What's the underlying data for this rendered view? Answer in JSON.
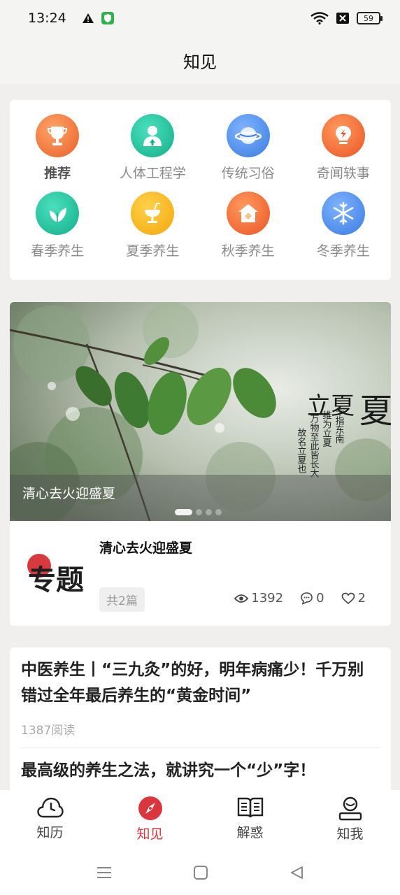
{
  "status_bar": {
    "time": "13:24",
    "battery": "59"
  },
  "header": {
    "title": "知见"
  },
  "categories": [
    {
      "label": "推荐",
      "icon": "trophy-icon",
      "color": "#f07a3a",
      "active": true
    },
    {
      "label": "人体工程学",
      "icon": "person-icon",
      "color": "#22c3a0",
      "active": false
    },
    {
      "label": "传统习俗",
      "icon": "planet-icon",
      "color": "#4f8fe8",
      "active": false
    },
    {
      "label": "奇闻轶事",
      "icon": "bulb-icon",
      "color": "#f06a3a",
      "active": false
    },
    {
      "label": "春季养生",
      "icon": "leaf-icon",
      "color": "#22c3a0",
      "active": false
    },
    {
      "label": "夏季养生",
      "icon": "drink-icon",
      "color": "#f7b61d",
      "active": false
    },
    {
      "label": "秋季养生",
      "icon": "house-icon",
      "color": "#f07a3a",
      "active": false
    },
    {
      "label": "冬季养生",
      "icon": "snowflake-icon",
      "color": "#4f8fe8",
      "active": false
    }
  ],
  "banner": {
    "caption": "清心去火迎盛夏",
    "calligraphy_main": "夏",
    "calligraphy_text": "立夏"
  },
  "topic": {
    "logo_text": "专题",
    "title": "清心去火迎盛夏",
    "count": "共2篇",
    "views": "1392",
    "comments": "0",
    "likes": "2"
  },
  "articles": [
    {
      "title": "中医养生丨“三九灸”的好，明年病痛少！千万别错过全年最后养生的“黄金时间”",
      "reads": "1387阅读"
    },
    {
      "title": "最高级的养生之法，就讲究一个“少”字！"
    }
  ],
  "tabbar": [
    {
      "label": "知历",
      "icon": "clock-icon",
      "active": false
    },
    {
      "label": "知见",
      "icon": "compass-icon",
      "active": true
    },
    {
      "label": "解惑",
      "icon": "book-icon",
      "active": false
    },
    {
      "label": "知我",
      "icon": "user-icon",
      "active": false
    }
  ],
  "colors": {
    "accent": "#d9363e"
  }
}
